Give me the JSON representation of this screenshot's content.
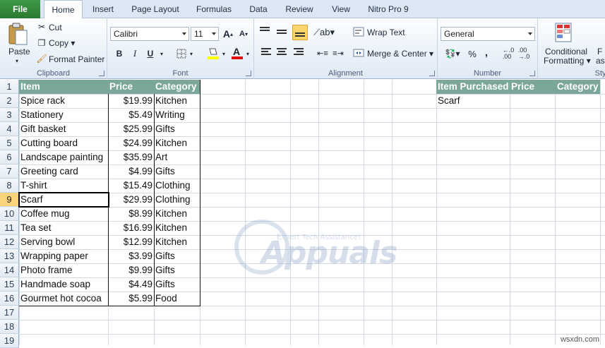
{
  "tabs": [
    "File",
    "Home",
    "Insert",
    "Page Layout",
    "Formulas",
    "Data",
    "Review",
    "View",
    "Nitro Pro 9"
  ],
  "ribbon": {
    "clipboard": {
      "paste": "Paste",
      "cut": "Cut",
      "copy": "Copy",
      "format_painter": "Format Painter",
      "label": "Clipboard"
    },
    "font": {
      "name": "Calibri",
      "size": "11",
      "bold": "B",
      "italic": "I",
      "underline": "U",
      "label": "Font"
    },
    "alignment": {
      "wrap": "Wrap Text",
      "merge": "Merge & Center",
      "label": "Alignment"
    },
    "number": {
      "format": "General",
      "percent": "%",
      "comma": ",",
      "label": "Number"
    },
    "styles": {
      "conditional": "Conditional",
      "formatting": "Formatting",
      "fa": "F",
      "as": "as",
      "label": "Styl"
    }
  },
  "row_numbers": [
    "1",
    "2",
    "3",
    "4",
    "5",
    "6",
    "7",
    "8",
    "9",
    "10",
    "11",
    "12",
    "13",
    "14",
    "15",
    "16",
    "17",
    "18",
    "19"
  ],
  "table": {
    "headers": [
      "Item",
      "Price",
      "Category"
    ],
    "rows": [
      [
        "Spice rack",
        "$19.99",
        "Kitchen"
      ],
      [
        "Stationery",
        "$5.49",
        "Writing"
      ],
      [
        "Gift basket",
        "$25.99",
        "Gifts"
      ],
      [
        "Cutting board",
        "$24.99",
        "Kitchen"
      ],
      [
        "Landscape painting",
        "$35.99",
        "Art"
      ],
      [
        "Greeting card",
        "$4.99",
        "Gifts"
      ],
      [
        "T-shirt",
        "$15.49",
        "Clothing"
      ],
      [
        "Scarf",
        "$29.99",
        "Clothing"
      ],
      [
        "Coffee mug",
        "$8.99",
        "Kitchen"
      ],
      [
        "Tea set",
        "$16.99",
        "Kitchen"
      ],
      [
        "Serving bowl",
        "$12.99",
        "Kitchen"
      ],
      [
        "Wrapping paper",
        "$3.99",
        "Gifts"
      ],
      [
        "Photo frame",
        "$9.99",
        "Gifts"
      ],
      [
        "Handmade soap",
        "$4.49",
        "Gifts"
      ],
      [
        "Gourmet hot cocoa",
        "$5.99",
        "Food"
      ]
    ]
  },
  "lookup": {
    "headers": [
      "Item Purchased",
      "Price",
      "Category"
    ],
    "value": "Scarf"
  },
  "selected_row": "9",
  "watermark": {
    "brand": "Appuals",
    "tagline": "Expert Tech Assistance!"
  },
  "site": "wsxdn.com",
  "colors": {
    "header_fill": "#7ba79a",
    "file_tab": "#2f7d35",
    "selected_row_header": "#f9d47a"
  }
}
